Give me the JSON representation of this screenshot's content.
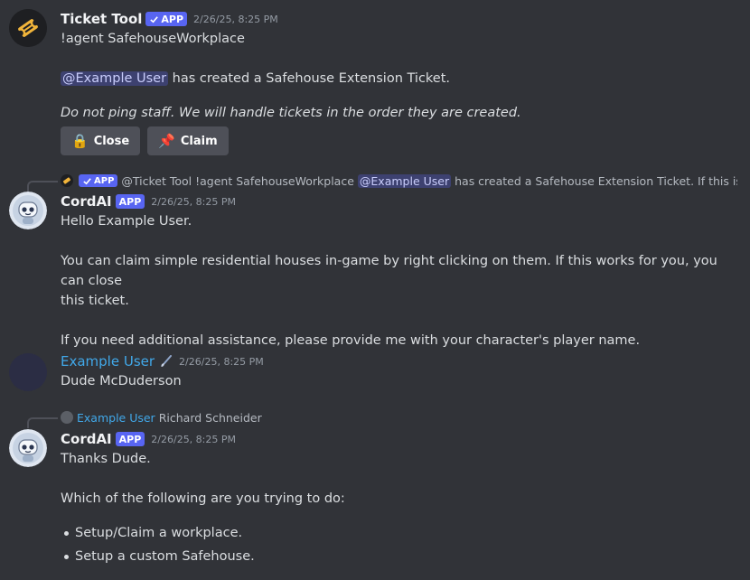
{
  "messages": {
    "ticket_tool": {
      "username": "Ticket Tool",
      "badge": "APP",
      "timestamp": "2/26/25, 8:25 PM",
      "line1": "!agent SafehouseWorkplace",
      "mention": "@Example User",
      "line2_rest": " has created a Safehouse Extension Ticket.",
      "line3": "Do not ping staff. We will handle tickets in the order they are created.",
      "buttons": {
        "close_label": "Close",
        "close_emoji": "🔒",
        "claim_label": "Claim",
        "claim_emoji": "📌"
      }
    },
    "cordai_1": {
      "reply": {
        "badge": "APP",
        "name": "@Ticket Tool",
        "text1": "!agent SafehouseWorkplace",
        "mention": "@Example User",
        "text2": "has created a Safehouse Extension Ticket.  If this is ..."
      },
      "username": "CordAI",
      "badge": "APP",
      "timestamp": "2/26/25, 8:25 PM",
      "line1": "Hello Example User.",
      "line2": "You can claim simple residential houses in-game by right clicking on them. If this works for you, you can close",
      "line3": "this ticket.",
      "line4": "If you need additional assistance, please provide me with your character's player name."
    },
    "example_user": {
      "username": "Example User",
      "timestamp": "2/26/25, 8:25 PM",
      "line1": "Dude McDuderson"
    },
    "cordai_2": {
      "reply": {
        "name": "Example User",
        "text": "Richard Schneider"
      },
      "username": "CordAI",
      "badge": "APP",
      "timestamp": "2/26/25, 8:25 PM",
      "line1": "Thanks Dude.",
      "line2": "Which of the following are you trying to do:",
      "bullets": [
        "Setup/Claim a workplace.",
        "Setup a custom Safehouse."
      ]
    }
  },
  "colors": {
    "background": "#313338",
    "blurple": "#5865f2",
    "link_blue": "#41a8e9",
    "button_gray": "#4e5058"
  },
  "icons": {
    "ticket_tool_avatar": "ticket-icon",
    "cordai_avatar": "robot-icon",
    "verified": "check-icon",
    "role_icon": "paintbrush-icon"
  }
}
